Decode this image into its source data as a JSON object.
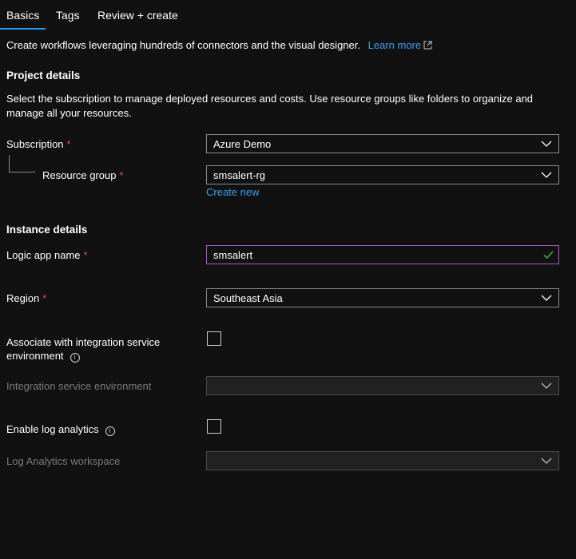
{
  "tabs": [
    {
      "label": "Basics",
      "active": true
    },
    {
      "label": "Tags"
    },
    {
      "label": "Review + create"
    }
  ],
  "intro": {
    "text": "Create workflows leveraging hundreds of connectors and the visual designer.",
    "link": "Learn more",
    "link_icon": "external-link-icon"
  },
  "project": {
    "title": "Project details",
    "description": "Select the subscription to manage deployed resources and costs. Use resource groups like folders to organize and manage all your resources.",
    "subscription": {
      "label": "Subscription",
      "required": "*",
      "value": "Azure Demo"
    },
    "resource_group": {
      "label": "Resource group",
      "required": "*",
      "value": "smsalert-rg",
      "create_new": "Create new"
    }
  },
  "instance": {
    "title": "Instance details",
    "logic_app_name": {
      "label": "Logic app name",
      "required": "*",
      "value": "smsalert"
    },
    "region": {
      "label": "Region",
      "required": "*",
      "value": "Southeast Asia"
    },
    "ise_associate": {
      "label_line1": "Associate with integration service",
      "label_line2": "environment",
      "checked": false
    },
    "ise": {
      "label": "Integration service environment",
      "value": ""
    },
    "log_analytics": {
      "label": "Enable log analytics",
      "checked": false
    },
    "log_workspace": {
      "label": "Log Analytics workspace",
      "value": ""
    }
  },
  "colors": {
    "background": "#111111",
    "accent": "#2899f5",
    "link": "#3aa0f3",
    "required": "#e8485c",
    "valid_check": "#3fb950",
    "valid_border": "#a55cc4"
  }
}
